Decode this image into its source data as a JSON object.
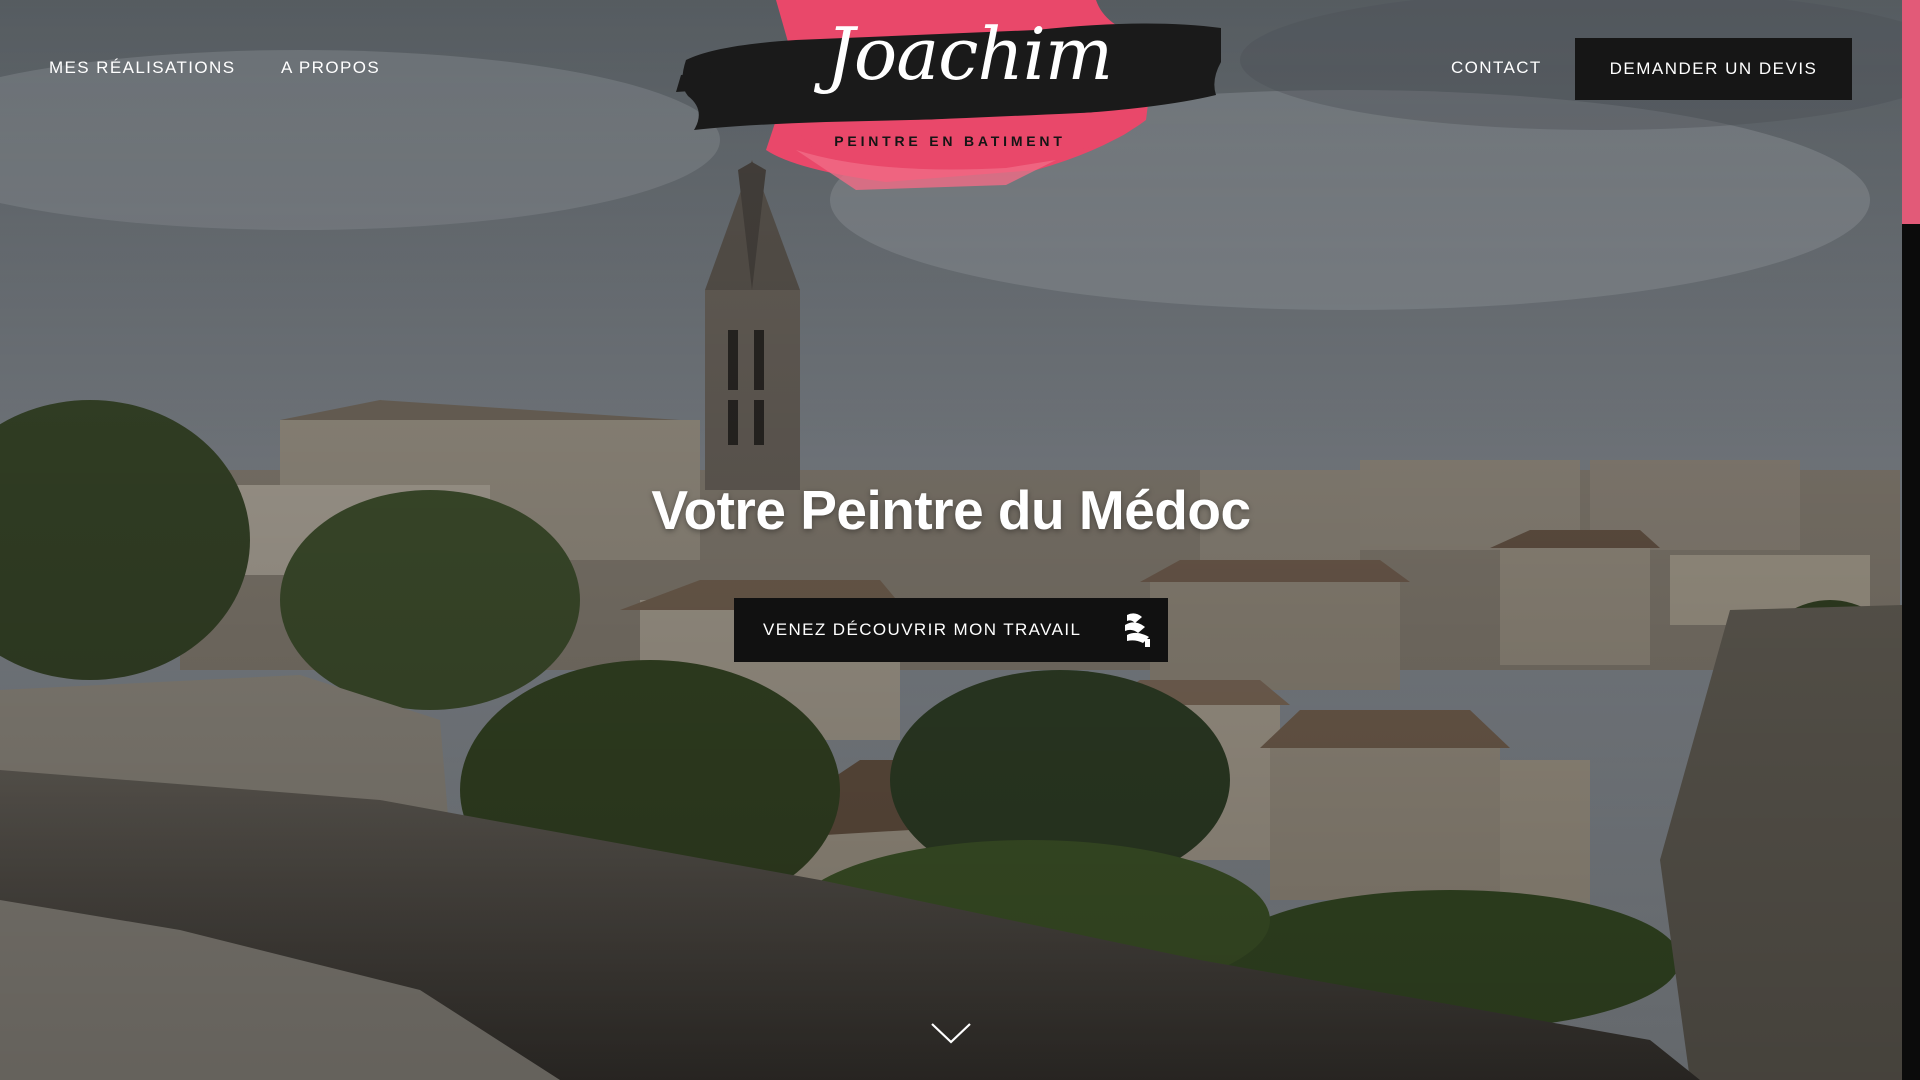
{
  "nav": {
    "left_items": [
      {
        "label": "MES RÉALISATIONS"
      },
      {
        "label": "A PROPOS"
      }
    ],
    "contact_label": "CONTACT",
    "quote_button_label": "DEMANDER UN DEVIS"
  },
  "logo": {
    "name": "Joachim",
    "tagline": "PEINTRE EN BATIMENT"
  },
  "hero": {
    "headline": "Votre Peintre du Médoc",
    "cta_label": "VENEZ DÉCOUVRIR MON TRAVAIL",
    "cta_icon": "paint-roller-icon",
    "scroll_icon": "chevron-down-icon"
  },
  "colors": {
    "accent_pink": "#e9486a",
    "button_dark": "#161616",
    "nav_text": "#ffffff"
  }
}
